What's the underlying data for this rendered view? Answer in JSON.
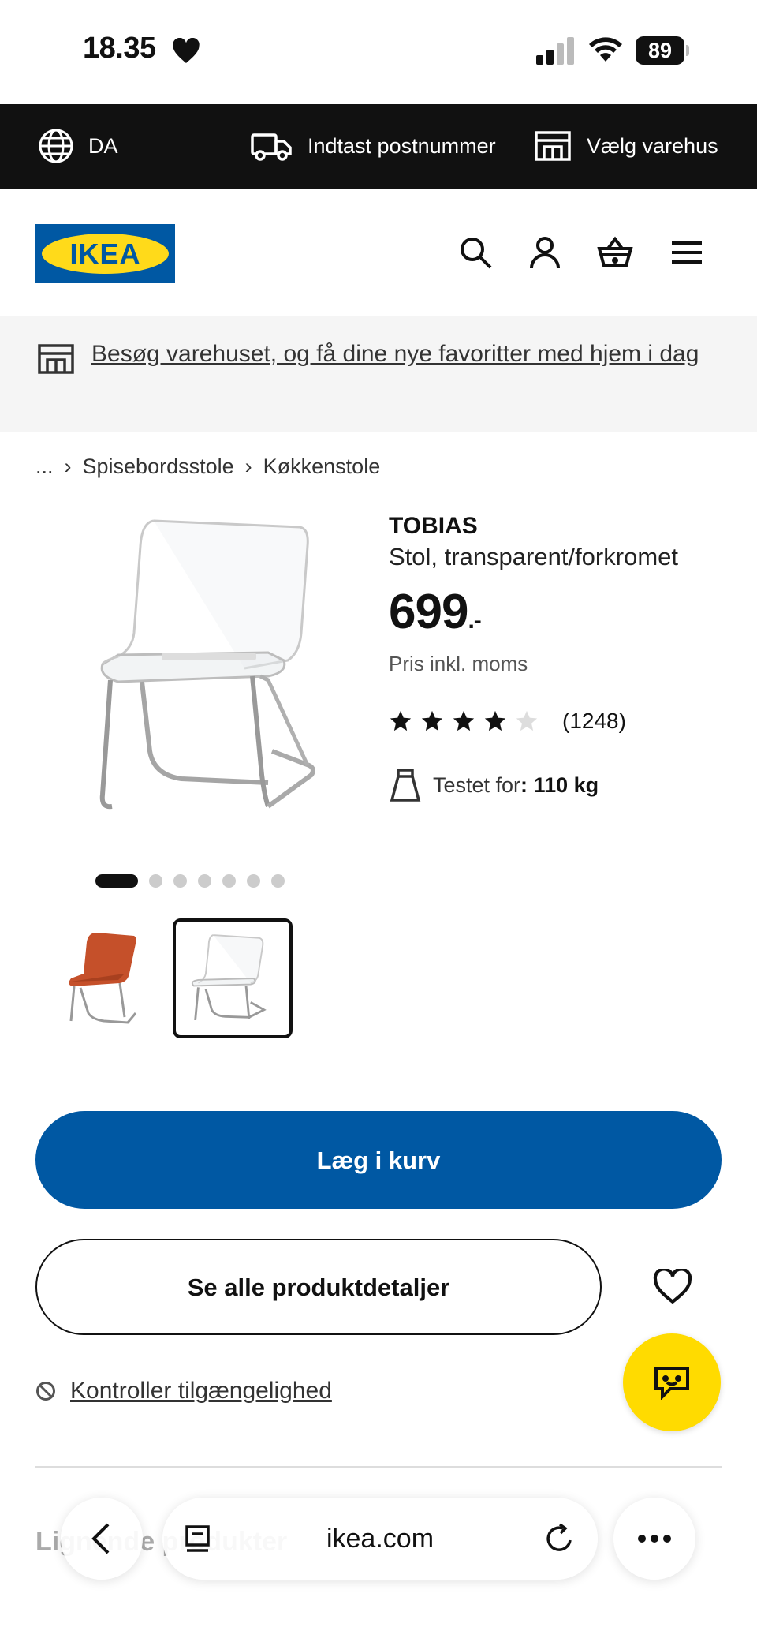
{
  "status_bar": {
    "time": "18.35",
    "battery": "89"
  },
  "top_bar": {
    "language": "DA",
    "postal_label": "Indtast postnummer",
    "store_label": "Vælg varehus"
  },
  "header": {
    "logo_text": "IKEA",
    "icons": [
      "search-icon",
      "account-icon",
      "basket-icon",
      "menu-icon"
    ]
  },
  "banner": {
    "text": "Besøg varehuset, og få dine nye favoritter med hjem i dag"
  },
  "breadcrumb": {
    "ellipsis": "...",
    "items": [
      "Spisebordsstole",
      "Køkkenstole"
    ]
  },
  "product": {
    "name": "TOBIAS",
    "description": "Stol, transparent/forkromet",
    "price": "699",
    "price_suffix": ".-",
    "vat_note": "Pris inkl. moms",
    "rating": 4,
    "rating_max": 5,
    "review_count": "(1248)",
    "tested_label": "Testet for",
    "tested_value": ": 110 kg",
    "image_count": 7,
    "active_image": 1,
    "thumbnails": [
      "orange-chair",
      "transparent-chair"
    ]
  },
  "actions": {
    "add_to_cart": "Læg i kurv",
    "see_details": "Se alle produktdetaljer",
    "check_availability": "Kontroller tilgængelighed"
  },
  "section": {
    "title": "Lignende produkter"
  },
  "browser": {
    "domain": "ikea.com"
  },
  "colors": {
    "brand_blue": "#0058a3",
    "brand_yellow": "#ffda1a",
    "chat_yellow": "#ffdb00"
  }
}
